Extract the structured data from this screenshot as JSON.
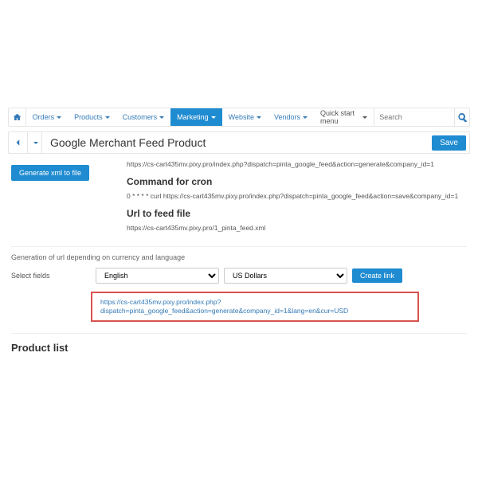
{
  "nav": {
    "home_icon": "⌂",
    "items": [
      "Orders",
      "Products",
      "Customers",
      "Marketing",
      "Website",
      "Vendors"
    ],
    "active_index": 3,
    "quickstart": "Quick start menu",
    "search_placeholder": "Search",
    "search_icon": "🔍"
  },
  "titlebar": {
    "back_icon": "←",
    "page_title": "Google Merchant Feed Product",
    "save_label": "Save"
  },
  "content": {
    "dispatch_url": "https://cs-cart435mv.pixy.pro/index.php?dispatch=pinta_google_feed&action=generate&company_id=1",
    "cron_heading": "Command for cron",
    "cron_text": "0 * * * * curl https://cs-cart435mv.pixy.pro/index.php?dispatch=pinta_google_feed&action=save&company_id=1",
    "feed_heading": "Url to feed file",
    "feed_url": "https://cs-cart435mv.pixy.pro/1_pinta_feed.xml",
    "generate_btn": "Generate xml to file",
    "helper_text": "Generation of url depending on currency and language",
    "select_fields_label": "Select fields",
    "language_value": "English",
    "currency_value": "US Dollars",
    "create_link_label": "Create link",
    "generated_link": "https://cs-cart435mv.pixy.pro/index.php?dispatch=pinta_google_feed&action=generate&company_id=1&lang=en&cur=USD",
    "product_list_heading": "Product list"
  }
}
